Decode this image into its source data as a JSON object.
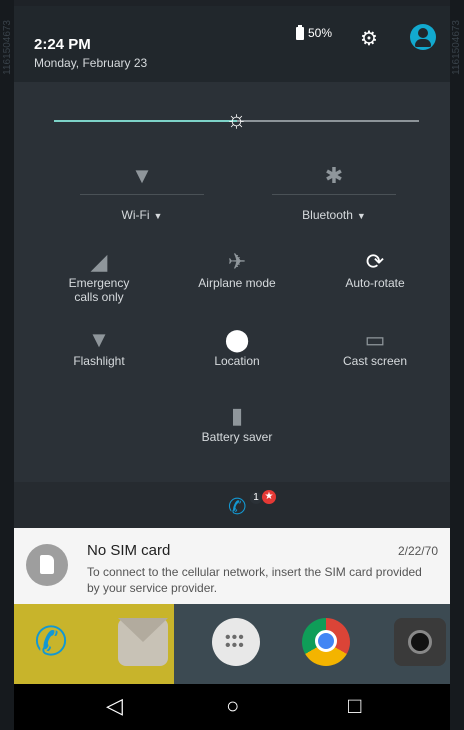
{
  "header": {
    "time": "2:24 PM",
    "date": "Monday, February 23",
    "battery_label": "50%",
    "icons": {
      "settings": "gear-icon",
      "user": "user-icon"
    }
  },
  "brightness": {
    "level_percent": 50
  },
  "tiles": {
    "wifi": {
      "label": "Wi-Fi"
    },
    "bluetooth": {
      "label": "Bluetooth"
    },
    "emergency": {
      "label": "Emergency calls only"
    },
    "airplane": {
      "label": "Airplane mode"
    },
    "autorotate": {
      "label": "Auto-rotate"
    },
    "flashlight": {
      "label": "Flashlight"
    },
    "location": {
      "label": "Location"
    },
    "cast": {
      "label": "Cast screen"
    },
    "battery_saver": {
      "label": "Battery saver"
    }
  },
  "notification_strip": {
    "count": "1"
  },
  "notification": {
    "title": "No SIM card",
    "date": "2/22/70",
    "body": "To connect to the cellular network, insert the SIM card provided by your service provider."
  },
  "watermark": "1161504673",
  "colors": {
    "accent": "#7dd3c8",
    "user_avatar": "#12a9cf",
    "phone_blue": "#1398d2",
    "badge_red": "#e53935"
  }
}
